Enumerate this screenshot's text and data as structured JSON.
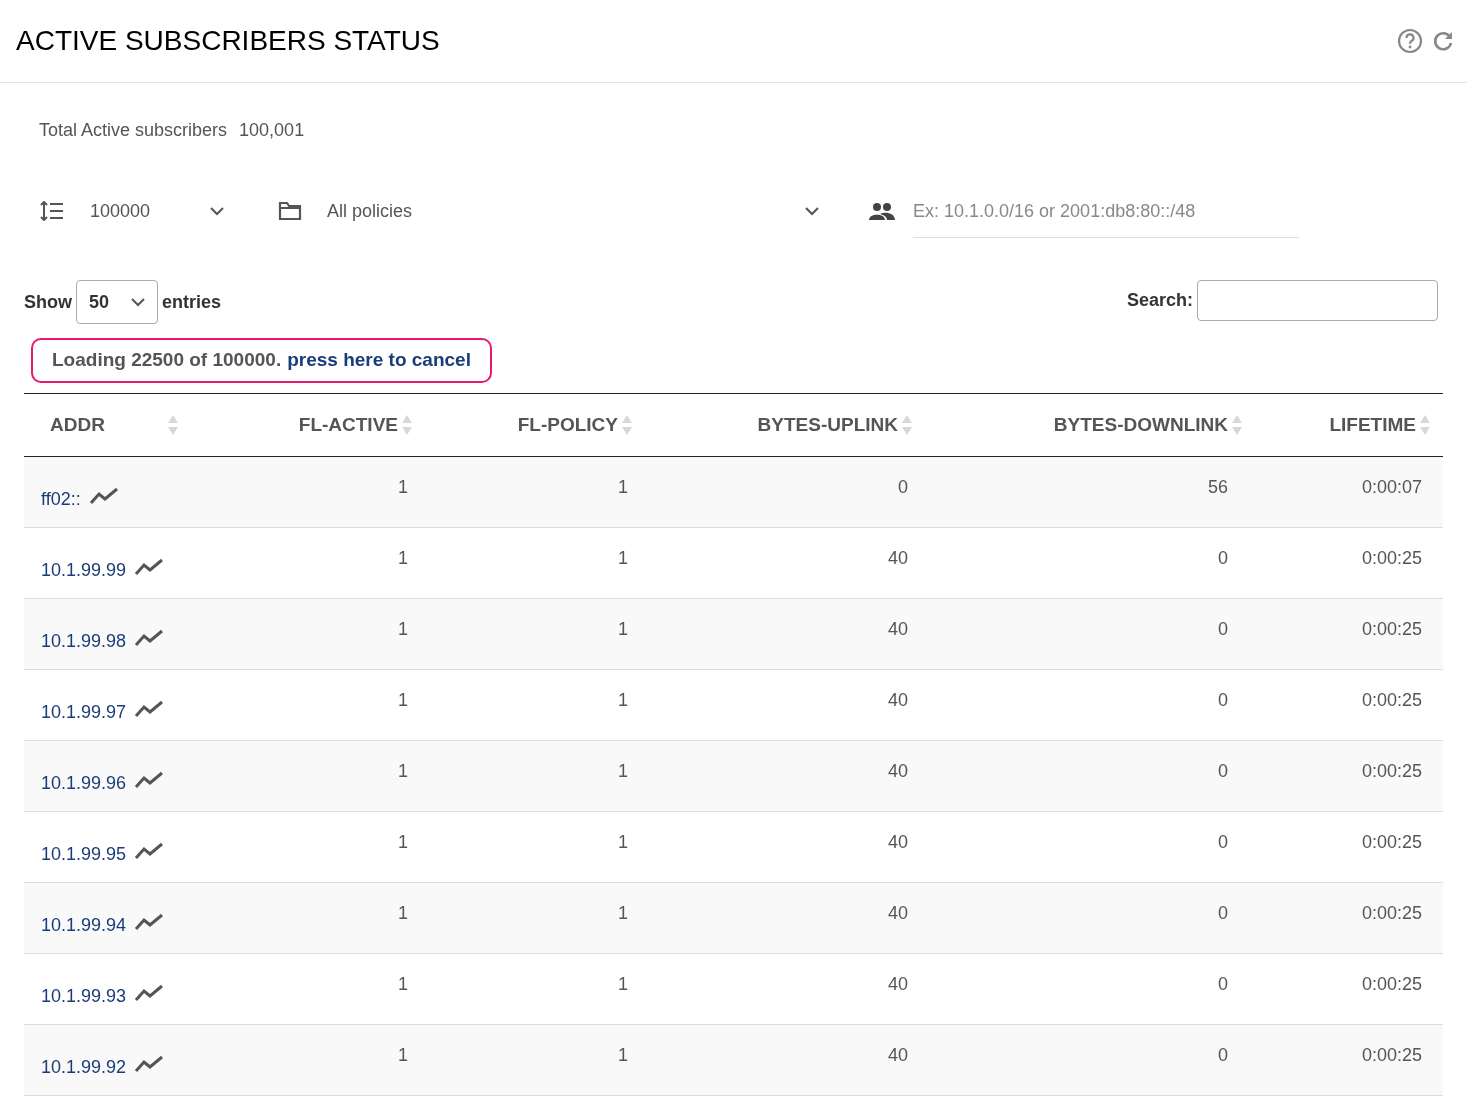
{
  "header": {
    "title": "ACTIVE SUBSCRIBERS STATUS"
  },
  "summary": {
    "label": "Total Active subscribers",
    "value": "100,001"
  },
  "filters": {
    "limit": "100000",
    "policy": "All policies",
    "subnet": {
      "placeholder": "Ex: 10.1.0.0/16 or 2001:db8:80::/48"
    }
  },
  "length_control": {
    "before": "Show",
    "value": "50",
    "after": "entries"
  },
  "search": {
    "label": "Search:"
  },
  "loading": {
    "message": "Loading 22500 of 100000.",
    "link": "press here to cancel"
  },
  "table": {
    "columns": [
      "ADDR",
      "FL-ACTIVE",
      "FL-POLICY",
      "BYTES-UPLINK",
      "BYTES-DOWNLINK",
      "LIFETIME"
    ],
    "rows": [
      [
        "ff02::",
        "1",
        "1",
        "0",
        "56",
        "0:00:07"
      ],
      [
        "10.1.99.99",
        "1",
        "1",
        "40",
        "0",
        "0:00:25"
      ],
      [
        "10.1.99.98",
        "1",
        "1",
        "40",
        "0",
        "0:00:25"
      ],
      [
        "10.1.99.97",
        "1",
        "1",
        "40",
        "0",
        "0:00:25"
      ],
      [
        "10.1.99.96",
        "1",
        "1",
        "40",
        "0",
        "0:00:25"
      ],
      [
        "10.1.99.95",
        "1",
        "1",
        "40",
        "0",
        "0:00:25"
      ],
      [
        "10.1.99.94",
        "1",
        "1",
        "40",
        "0",
        "0:00:25"
      ],
      [
        "10.1.99.93",
        "1",
        "1",
        "40",
        "0",
        "0:00:25"
      ],
      [
        "10.1.99.92",
        "1",
        "1",
        "40",
        "0",
        "0:00:25"
      ]
    ]
  }
}
